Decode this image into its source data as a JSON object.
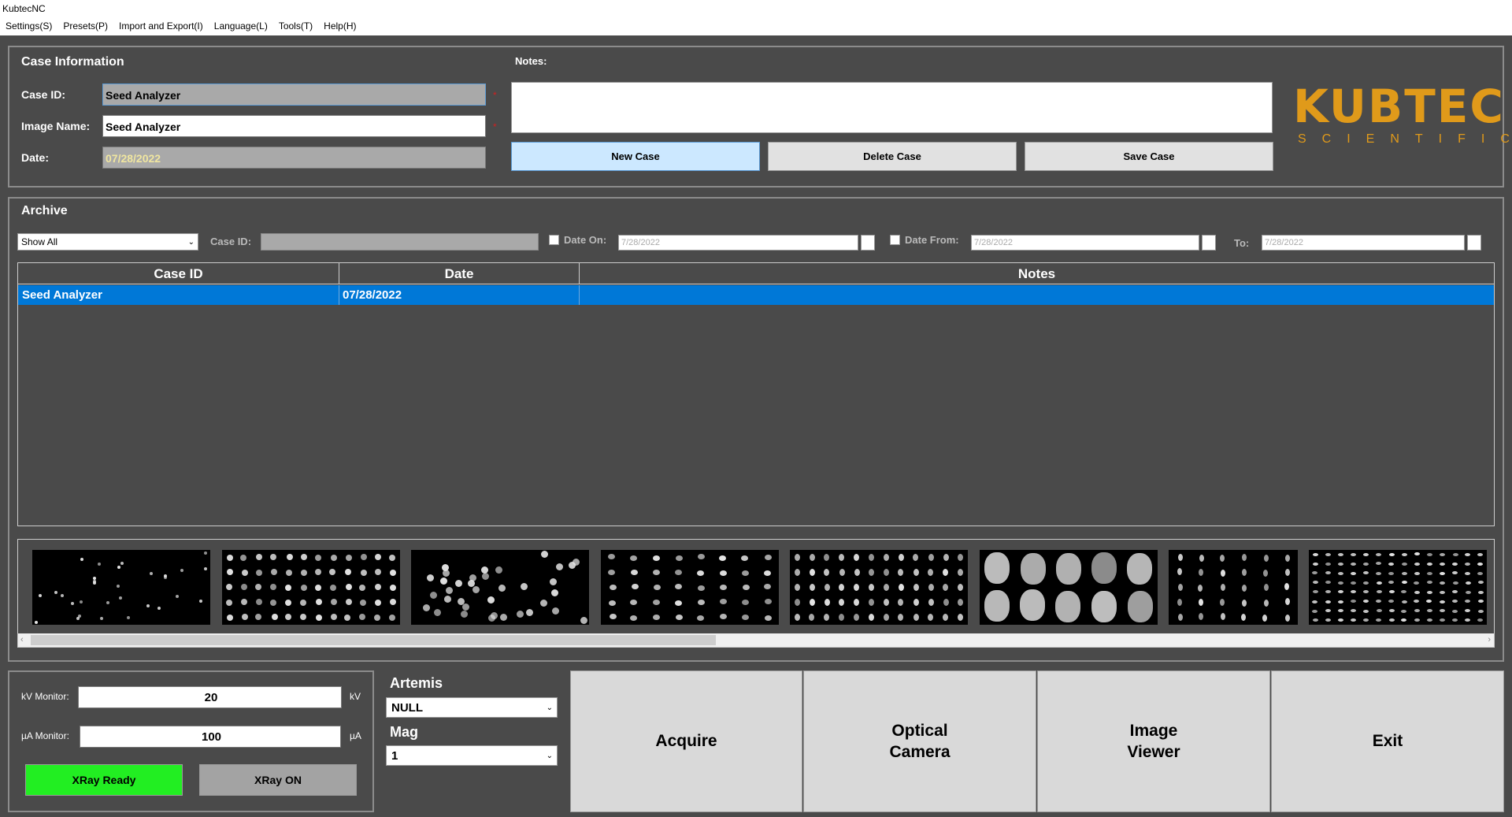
{
  "window": {
    "title": "KubtecNC"
  },
  "menu": [
    "Settings(S)",
    "Presets(P)",
    "Import and Export(I)",
    "Language(L)",
    "Tools(T)",
    "Help(H)"
  ],
  "case_info": {
    "title": "Case Information",
    "case_id_label": "Case ID:",
    "case_id_value": "Seed Analyzer",
    "image_name_label": "Image Name:",
    "image_name_value": "Seed Analyzer",
    "date_label": "Date:",
    "date_value": "07/28/2022",
    "required_mark": "*",
    "notes_label": "Notes:",
    "notes_value": "",
    "new_case": "New Case",
    "delete_case": "Delete Case",
    "save_case": "Save Case"
  },
  "logo": {
    "line1": "KUBTEC",
    "line2": "SCIENTIFIC"
  },
  "archive": {
    "title": "Archive",
    "filter_value": "Show All",
    "case_id_label": "Case ID:",
    "date_on_label": "Date On:",
    "date_on_value": "7/28/2022",
    "date_from_label": "Date From:",
    "date_from_value": "7/28/2022",
    "to_label": "To:",
    "to_value": "7/28/2022",
    "columns": [
      "Case ID",
      "Date",
      "Notes"
    ],
    "rows": [
      {
        "case_id": "Seed Analyzer",
        "date": "07/28/2022",
        "notes": ""
      }
    ]
  },
  "monitor": {
    "kv_label": "kV Monitor:",
    "kv_value": "20",
    "kv_unit": "kV",
    "ua_label": "µA Monitor:",
    "ua_value": "100",
    "ua_unit": "µA",
    "xray_ready": "XRay Ready",
    "xray_on": "XRay ON"
  },
  "artemis": {
    "title": "Artemis",
    "artemis_value": "NULL",
    "mag_label": "Mag",
    "mag_value": "1"
  },
  "actions": {
    "acquire": "Acquire",
    "optical_camera": "Optical\nCamera",
    "image_viewer": "Image\nViewer",
    "exit": "Exit"
  },
  "colors": {
    "accent": "#0078d7",
    "ready": "#22ee22",
    "logo": "#e09a1a"
  }
}
